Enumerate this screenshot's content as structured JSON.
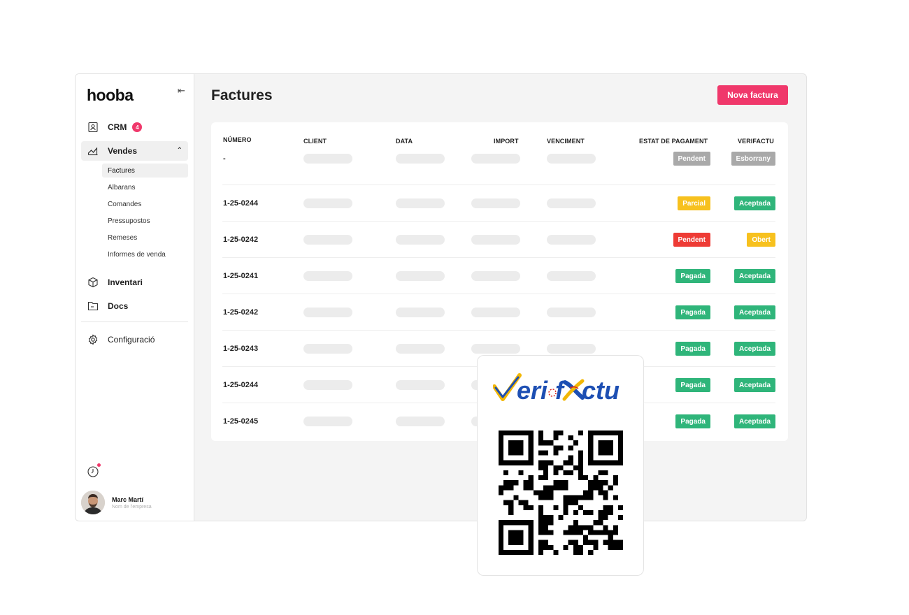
{
  "sidebar": {
    "logo": "hooba",
    "collapse_icon": "⇤",
    "crm": {
      "label": "CRM",
      "badge": "4"
    },
    "vendes": {
      "label": "Vendes"
    },
    "sub_items": [
      "Factures",
      "Albarans",
      "Comandes",
      "Pressupostos",
      "Remeses",
      "Informes de venda"
    ],
    "inventari": "Inventari",
    "docs": "Docs",
    "config": "Configuració",
    "user": {
      "name": "Marc Martí",
      "company": "Nom de l'empresa"
    }
  },
  "main": {
    "title": "Factures",
    "new_button": "Nova factura",
    "columns": [
      "NÚMERO",
      "CLIENT",
      "DATA",
      "IMPORT",
      "VENCIMENT",
      "ESTAT DE PAGAMENT",
      "VERIFACTU"
    ],
    "rows": [
      {
        "number": "-",
        "payment": "Pendent",
        "payment_color": "#a9a9a9",
        "verifactu": "Esborrany",
        "verifactu_color": "#a9a9a9"
      },
      {
        "number": "1-25-0244",
        "payment": "Parcial",
        "payment_color": "#f7c11e",
        "verifactu": "Aceptada",
        "verifactu_color": "#2fb57a"
      },
      {
        "number": "1-25-0242",
        "payment": "Pendent",
        "payment_color": "#ee3b35",
        "verifactu": "Obert",
        "verifactu_color": "#f7c11e"
      },
      {
        "number": "1-25-0241",
        "payment": "Pagada",
        "payment_color": "#2fb57a",
        "verifactu": "Aceptada",
        "verifactu_color": "#2fb57a"
      },
      {
        "number": "1-25-0242",
        "payment": "Pagada",
        "payment_color": "#2fb57a",
        "verifactu": "Aceptada",
        "verifactu_color": "#2fb57a"
      },
      {
        "number": "1-25-0243",
        "payment": "Pagada",
        "payment_color": "#2fb57a",
        "verifactu": "Aceptada",
        "verifactu_color": "#2fb57a"
      },
      {
        "number": "1-25-0244",
        "payment": "Pagada",
        "payment_color": "#2fb57a",
        "verifactu": "Aceptada",
        "verifactu_color": "#2fb57a"
      },
      {
        "number": "1-25-0245",
        "payment": "Pagada",
        "payment_color": "#2fb57a",
        "verifactu": "Aceptada",
        "verifactu_color": "#2fb57a"
      }
    ]
  },
  "verifactu_card": {
    "logo_text": "Verifactu",
    "qr_icon": "qr-code-icon"
  },
  "colors": {
    "accent": "#f0386b",
    "green": "#2fb57a",
    "yellow": "#f7c11e",
    "red": "#ee3b35",
    "grey": "#a9a9a9"
  }
}
